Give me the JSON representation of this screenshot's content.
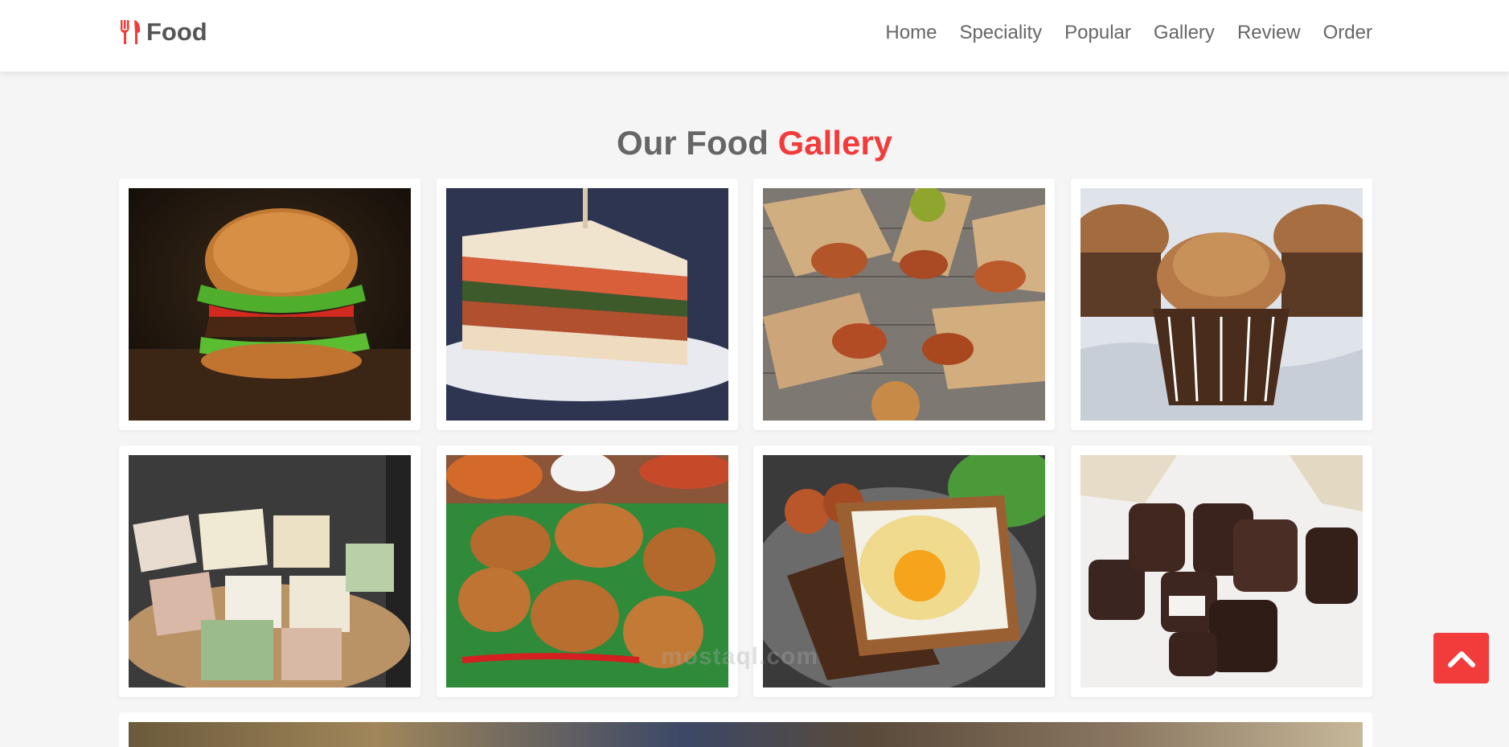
{
  "header": {
    "logo_text": "Food",
    "nav": [
      "Home",
      "Speciality",
      "Popular",
      "Gallery",
      "Review",
      "Order"
    ]
  },
  "section": {
    "title_main": "Our Food",
    "title_accent": "Gallery"
  },
  "gallery": [
    {
      "name": "burger"
    },
    {
      "name": "sandwich"
    },
    {
      "name": "wraps"
    },
    {
      "name": "cupcakes"
    },
    {
      "name": "cheese-cubes"
    },
    {
      "name": "fried-chicken"
    },
    {
      "name": "egg-toast"
    },
    {
      "name": "chocolates"
    }
  ],
  "watermark": "mostaql.com",
  "colors": {
    "accent": "#f23b3b",
    "text": "#666666",
    "background": "#f5f5f5"
  },
  "icons": {
    "logo": "utensils-icon",
    "scroll_top": "chevron-up-icon"
  }
}
